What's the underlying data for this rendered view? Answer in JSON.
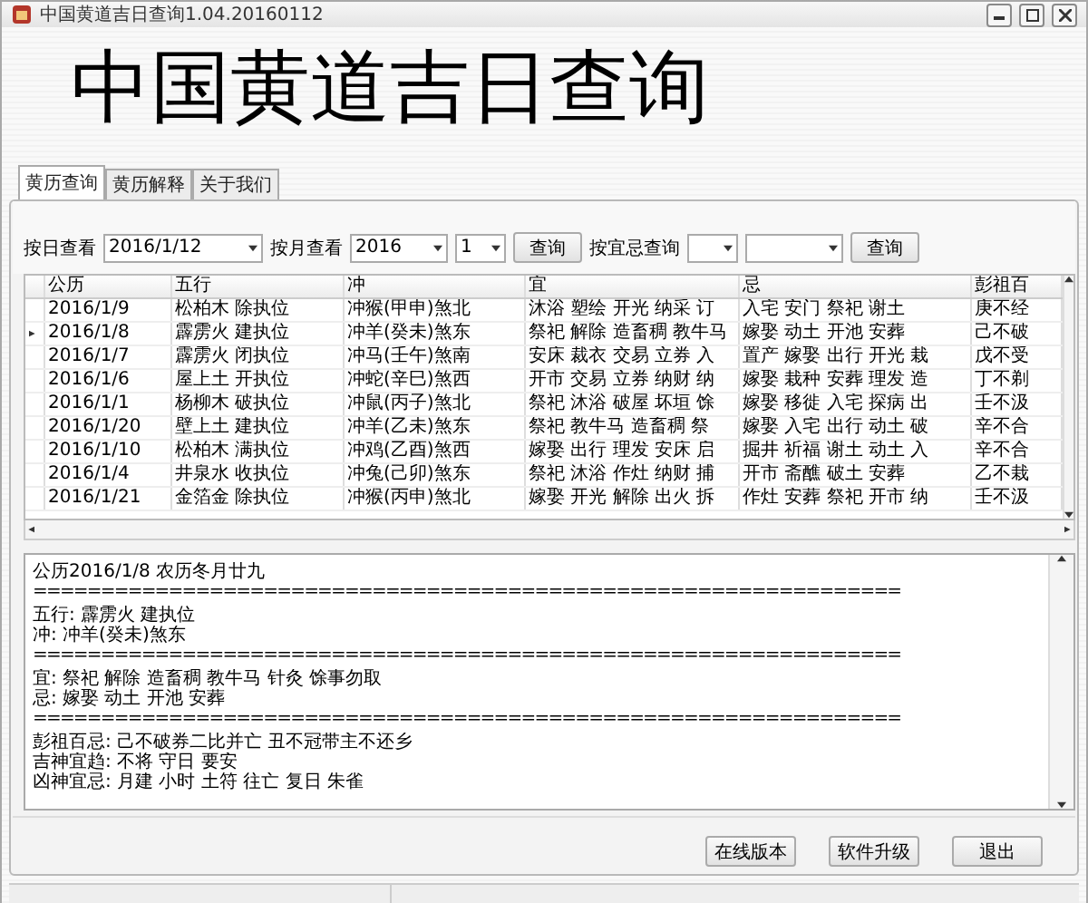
{
  "window": {
    "title": "中国黄道吉日查询1.04.20160112"
  },
  "banner": "中国黄道吉日查询",
  "tabs": [
    {
      "label": "黄历查询",
      "selected": true
    },
    {
      "label": "黄历解释",
      "selected": false
    },
    {
      "label": "关于我们",
      "selected": false
    }
  ],
  "query": [
    {
      "kind": "label",
      "text": "按日查看"
    },
    {
      "kind": "combo",
      "value": "2016/1/12"
    },
    {
      "kind": "label",
      "text": "按月查看"
    },
    {
      "kind": "combo",
      "value": "2016"
    },
    {
      "kind": "combo",
      "value": "1"
    },
    {
      "kind": "button",
      "text": "查询"
    },
    {
      "kind": "label",
      "text": "按宜忌查询"
    },
    {
      "kind": "combo"
    },
    {
      "kind": "combo"
    },
    {
      "kind": "button",
      "text": "查询"
    }
  ],
  "table": {
    "columns": [
      "公历",
      "五行",
      "冲",
      "宜",
      "忌",
      "彭祖百"
    ],
    "rows": [
      {
        "selected": false,
        "cells": [
          "2016/1/9",
          "松柏木 除执位",
          "冲猴(甲申)煞北",
          "沐浴 塑绘 开光 纳采 订",
          "入宅 安门 祭祀 谢土",
          "庚不经"
        ]
      },
      {
        "selected": true,
        "cells": [
          "2016/1/8",
          "霹雳火 建执位",
          "冲羊(癸未)煞东",
          "祭祀 解除 造畜稠 教牛马",
          "嫁娶 动土 开池 安葬",
          "己不破"
        ]
      },
      {
        "selected": false,
        "cells": [
          "2016/1/7",
          "霹雳火 闭执位",
          "冲马(壬午)煞南",
          "安床 裁衣 交易 立券 入",
          "置产 嫁娶 出行 开光 栽",
          "戊不受"
        ]
      },
      {
        "selected": false,
        "cells": [
          "2016/1/6",
          "屋上土 开执位",
          "冲蛇(辛巳)煞西",
          "开市 交易 立券 纳财 纳",
          "嫁娶 栽种 安葬 理发 造",
          "丁不剃"
        ]
      },
      {
        "selected": false,
        "cells": [
          "2016/1/1",
          "杨柳木 破执位",
          "冲鼠(丙子)煞北",
          "祭祀 沐浴 破屋 坏垣 馀",
          "嫁娶 移徙 入宅 探病 出",
          "壬不汲"
        ]
      },
      {
        "selected": false,
        "cells": [
          "2016/1/20",
          "壁上土 建执位",
          "冲羊(乙未)煞东",
          "祭祀 教牛马 造畜稠 祭",
          "嫁娶 入宅 出行 动土 破",
          "辛不合"
        ]
      },
      {
        "selected": false,
        "cells": [
          "2016/1/10",
          "松柏木 满执位",
          "冲鸡(乙酉)煞西",
          "嫁娶 出行 理发 安床 启",
          "掘井 祈福 谢土 动土 入",
          "辛不合"
        ]
      },
      {
        "selected": false,
        "cells": [
          "2016/1/4",
          "井泉水 收执位",
          "冲兔(己卯)煞东",
          "祭祀 沐浴 作灶 纳财 捕",
          "开市 斋醮 破土 安葬",
          "乙不栽"
        ]
      },
      {
        "selected": false,
        "cells": [
          "2016/1/21",
          "金箔金 除执位",
          "冲猴(丙申)煞北",
          "嫁娶 开光 解除 出火 拆",
          "作灶 安葬 祭祀 开市 纳",
          "壬不汲"
        ]
      }
    ]
  },
  "details": [
    "公历2016/1/8 农历冬月廿九",
    "================================================================",
    "五行: 霹雳火 建执位",
    "冲: 冲羊(癸未)煞东",
    "================================================================",
    "宜: 祭祀 解除 造畜稠 教牛马 针灸 馀事勿取",
    "忌: 嫁娶 动土 开池 安葬",
    "================================================================",
    "彭祖百忌: 己不破券二比并亡 丑不冠带主不还乡",
    "吉神宜趋: 不将 守日 要安",
    "凶神宜忌: 月建 小时 土符 往亡 复日 朱雀"
  ],
  "buttons": [
    "在线版本",
    "软件升级",
    "退出"
  ]
}
